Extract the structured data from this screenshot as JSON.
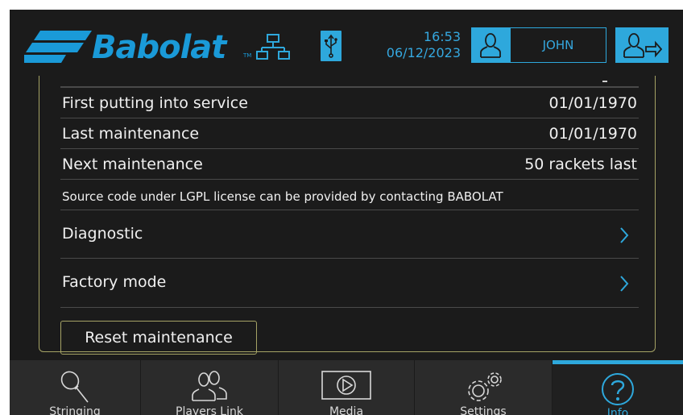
{
  "header": {
    "brand": "Babolat",
    "time": "16:53",
    "date": "06/12/2023",
    "user_name": "JOHN",
    "icons": [
      "network-icon",
      "usb-icon",
      "user-icon",
      "logout-icon"
    ]
  },
  "info_rows": [
    {
      "label": "First putting into service",
      "value": "01/01/1970"
    },
    {
      "label": "Last maintenance",
      "value": "01/01/1970"
    },
    {
      "label": "Next maintenance",
      "value": "50 rackets last"
    }
  ],
  "license_text": "Source code under LGPL license can be provided by contacting BABOLAT",
  "nav_rows": [
    {
      "label": "Diagnostic"
    },
    {
      "label": "Factory mode"
    }
  ],
  "reset_button": "Reset maintenance",
  "tabs": [
    {
      "label": "Stringing",
      "icon": "racket-icon"
    },
    {
      "label": "Players Link",
      "icon": "players-icon"
    },
    {
      "label": "Media",
      "icon": "play-icon"
    },
    {
      "label": "Settings",
      "icon": "gears-icon"
    },
    {
      "label": "Info",
      "icon": "question-icon",
      "active": true
    }
  ],
  "colors": {
    "accent": "#2ea8dc",
    "background": "#1b1b1b",
    "panel_border": "#a5a365",
    "text": "#f0f0f0"
  }
}
